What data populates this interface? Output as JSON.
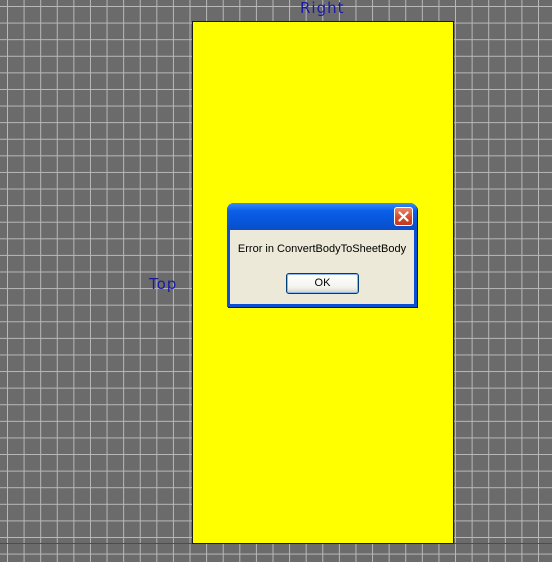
{
  "viewport": {
    "labels": {
      "right": "Right",
      "top": "Top"
    },
    "colors": {
      "background": "#6b6b6b",
      "grid": "#b9b9b9",
      "face": "#ffff00",
      "label": "#1a1a9e",
      "axis": "#3b3bd8"
    }
  },
  "dialog": {
    "message": "Error in ConvertBodyToSheetBody",
    "ok_label": "OK",
    "close_icon": "close-icon",
    "colors": {
      "title_bar": "#0754d6",
      "body": "#ece9d8",
      "close_button": "#d8492a"
    }
  }
}
